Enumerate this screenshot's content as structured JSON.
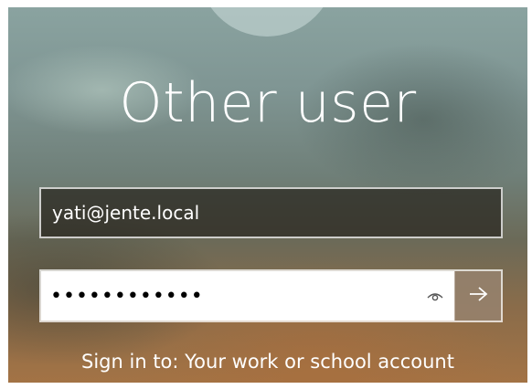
{
  "login": {
    "title": "Other user",
    "username": {
      "value": "yati@jente.local"
    },
    "password": {
      "masked_value": "••••••••••••"
    },
    "reveal_icon": "eye-icon",
    "submit_icon": "arrow-right-icon",
    "sign_in_to": "Sign in to: Your work or school account"
  },
  "colors": {
    "field_dark_bg": "#2a261e",
    "field_border": "#ffffff",
    "submit_bg": "#968270",
    "text": "#ffffff"
  }
}
